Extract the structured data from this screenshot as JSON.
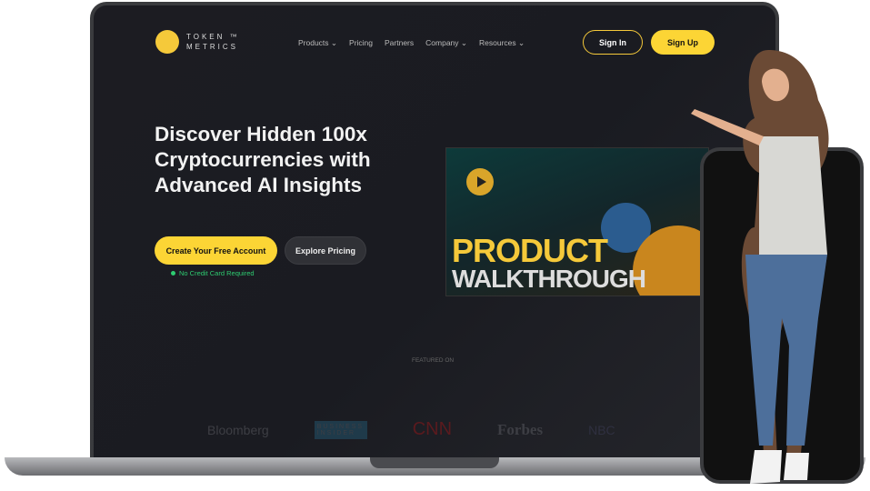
{
  "logo": {
    "line1": "TOKEN ™",
    "line2": "METRICS"
  },
  "nav": [
    {
      "label": "Products ⌄"
    },
    {
      "label": "Pricing"
    },
    {
      "label": "Partners"
    },
    {
      "label": "Company ⌄"
    },
    {
      "label": "Resources ⌄"
    }
  ],
  "header": {
    "sign_in": "Sign In",
    "sign_up": "Sign Up"
  },
  "hero": {
    "title": "Discover Hidden 100x Cryptocurrencies with Advanced AI Insights",
    "cta_primary": "Create Your Free Account",
    "cta_secondary": "Explore Pricing",
    "note": "No Credit Card Required"
  },
  "video": {
    "line1": "PRODUCT",
    "line2": "WALKTHROUGH"
  },
  "featured": {
    "label": "FEATURED ON",
    "brands": [
      "Bloomberg",
      "BUSINESS INSIDER",
      "CNN",
      "Forbes",
      "NBC"
    ]
  },
  "colors": {
    "accent": "#fcd535",
    "success": "#2ecc71",
    "background": "#1c1c22"
  }
}
